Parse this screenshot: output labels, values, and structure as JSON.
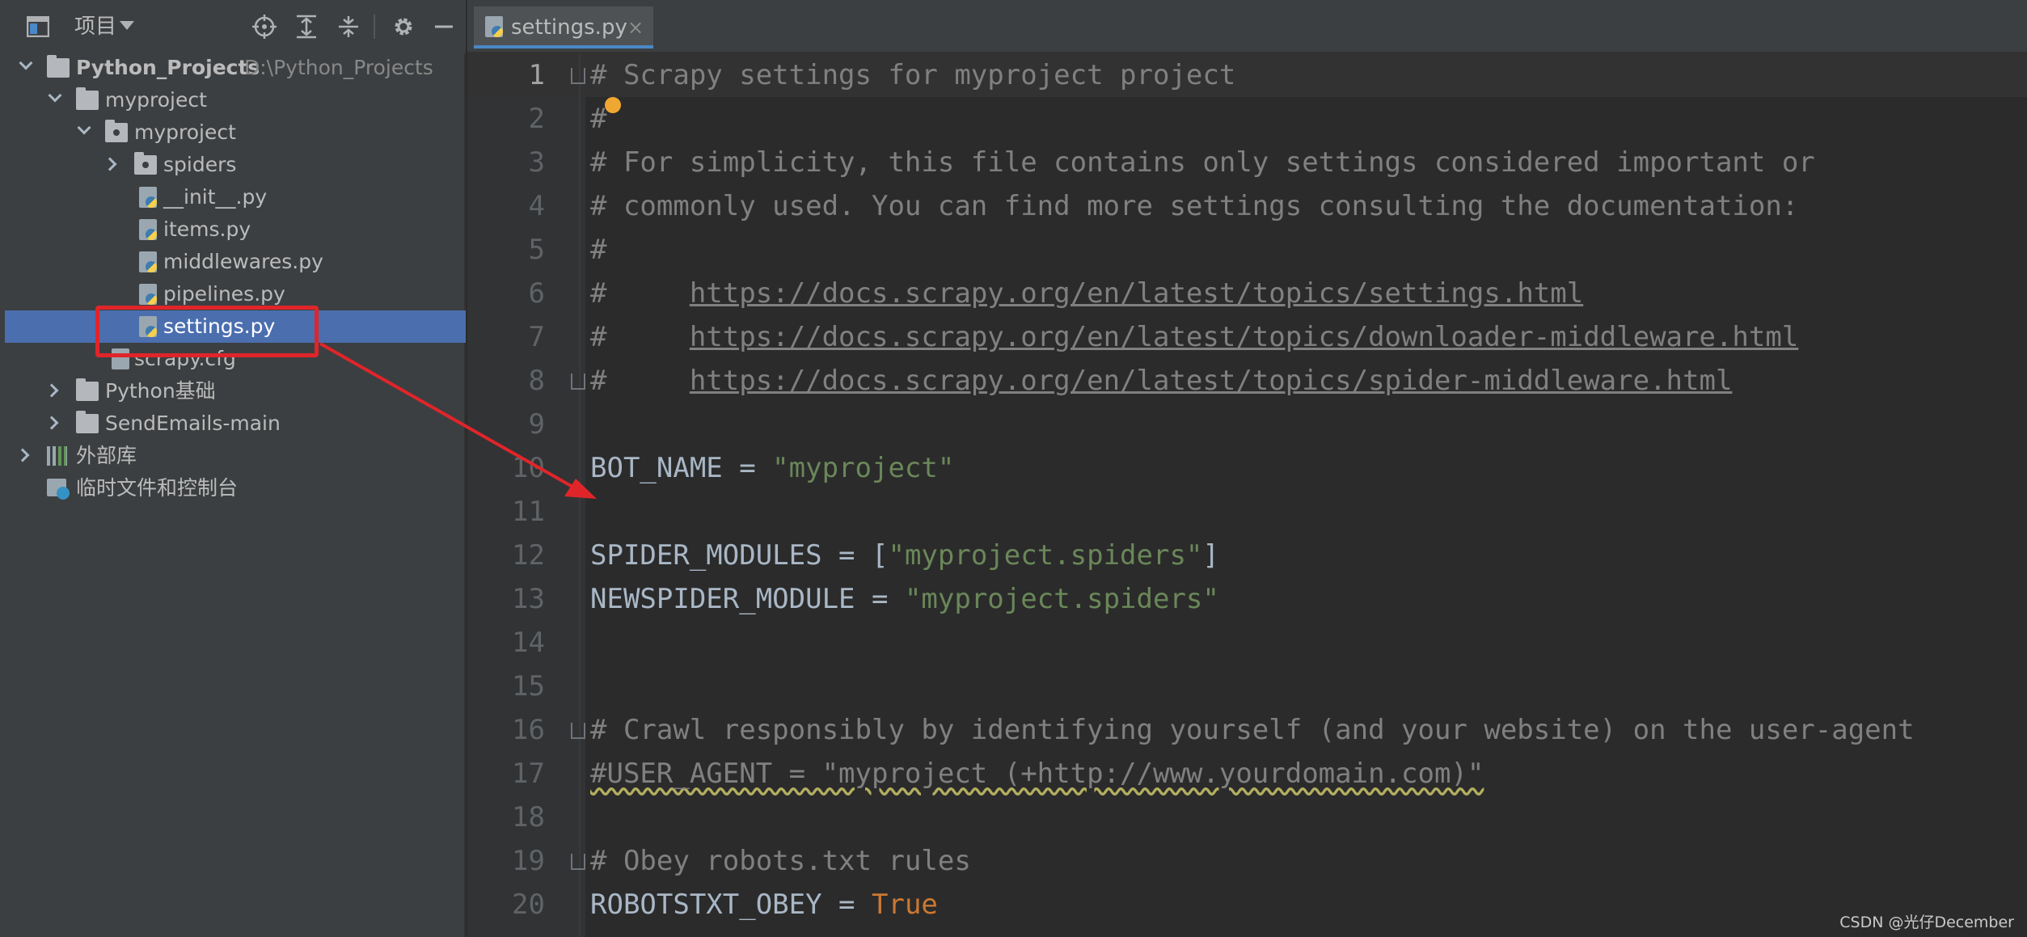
{
  "panel": {
    "title": "项目"
  },
  "tree": {
    "root": {
      "label": "Python_Projects",
      "path": "D:\\Python_Projects"
    },
    "myproject_outer": "myproject",
    "myproject_inner": "myproject",
    "spiders": "spiders",
    "init": "__init__.py",
    "items": "items.py",
    "middlewares": "middlewares.py",
    "pipelines": "pipelines.py",
    "settings": "settings.py",
    "scrapy_cfg": "scrapy.cfg",
    "python_basics": "Python基础",
    "sendemails": "SendEmails-main",
    "external_libs": "外部库",
    "scratches": "临时文件和控制台"
  },
  "tab": {
    "label": "settings.py",
    "close": "×"
  },
  "lines": [
    "1",
    "2",
    "3",
    "4",
    "5",
    "6",
    "7",
    "8",
    "9",
    "10",
    "11",
    "12",
    "13",
    "14",
    "15",
    "16",
    "17",
    "18",
    "19",
    "20"
  ],
  "code": {
    "l1": "# Scrapy settings for myproject project",
    "l2": "#",
    "l3": "# For simplicity, this file contains only settings considered important or",
    "l4": "# commonly used. You can find more settings consulting the documentation:",
    "l5": "#",
    "l6_prefix": "#     ",
    "l6_link": "https://docs.scrapy.org/en/latest/topics/settings.html",
    "l7_prefix": "#     ",
    "l7_link": "https://docs.scrapy.org/en/latest/topics/downloader-middleware.html",
    "l8_prefix": "#     ",
    "l8_link": "https://docs.scrapy.org/en/latest/topics/spider-middleware.html",
    "l10_name": "BOT_NAME = ",
    "l10_value": "\"myproject\"",
    "l12_name": "SPIDER_MODULES = [",
    "l12_value": "\"myproject.spiders\"",
    "l12_end": "]",
    "l13_name": "NEWSPIDER_MODULE = ",
    "l13_value": "\"myproject.spiders\"",
    "l16": "# Crawl responsibly by identifying yourself (and your website) on the user-agent",
    "l17": "#USER_AGENT = \"myproject (+http://www.yourdomain.com)\"",
    "l19": "# Obey robots.txt rules",
    "l20_name": "ROBOTSTXT_OBEY = ",
    "l20_value": "True"
  },
  "watermark": "CSDN @光仔December",
  "colors": {
    "selection": "#4b6eaf",
    "annotation": "#e0252a",
    "string": "#6a8759",
    "keyword": "#cc7832",
    "comment": "#808080"
  }
}
